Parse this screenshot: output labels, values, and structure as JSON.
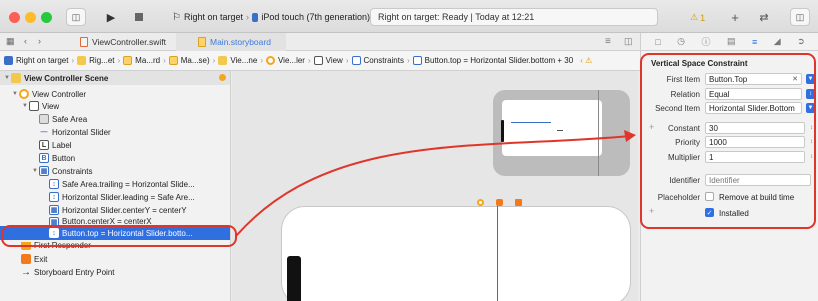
{
  "toolbar": {
    "scheme_target": "Right on target",
    "scheme_device": "iPod touch (7th generation)",
    "status_text": "Right on target: Ready | Today at 12:21",
    "warning_count": "1"
  },
  "tabs": [
    {
      "label": "ViewController.swift"
    },
    {
      "label": "Main.storyboard"
    }
  ],
  "jumpbar": [
    "Right on target",
    "Rig...et",
    "Ma...rd",
    "Ma...se)",
    "Vie...ne",
    "Vie...ler",
    "View",
    "Constraints",
    "Button.top = Horizontal Slider.bottom + 30"
  ],
  "outline": {
    "scene": "View Controller Scene",
    "items": [
      {
        "label": "View Controller"
      },
      {
        "label": "View"
      },
      {
        "label": "Safe Area"
      },
      {
        "label": "Horizontal Slider"
      },
      {
        "label": "Label"
      },
      {
        "label": "Button"
      },
      {
        "label": "Constraints"
      },
      {
        "label": "Safe Area.trailing = Horizontal Slide..."
      },
      {
        "label": "Horizontal Slider.leading = Safe Are..."
      },
      {
        "label": "Horizontal Slider.centerY = centerY"
      },
      {
        "label": "Button.centerX = centerX"
      },
      {
        "label": "Button.top = Horizontal Slider.botto..."
      },
      {
        "label": "First Responder"
      },
      {
        "label": "Exit"
      },
      {
        "label": "Storyboard Entry Point"
      }
    ]
  },
  "inspector": {
    "title": "Vertical Space Constraint",
    "first_item_label": "First Item",
    "first_item_value": "Button.Top",
    "relation_label": "Relation",
    "relation_value": "Equal",
    "second_item_label": "Second Item",
    "second_item_value": "Horizontal Slider.Bottom",
    "constant_label": "Constant",
    "constant_value": "30",
    "priority_label": "Priority",
    "priority_value": "1000",
    "multiplier_label": "Multiplier",
    "multiplier_value": "1",
    "identifier_label": "Identifier",
    "identifier_placeholder": "Identifier",
    "placeholder_label": "Placeholder",
    "placeholder_check_text": "Remove at build time",
    "installed_text": "Installed"
  },
  "colors": {
    "accent": "#2f6fe0",
    "annotation": "#e0352b"
  }
}
